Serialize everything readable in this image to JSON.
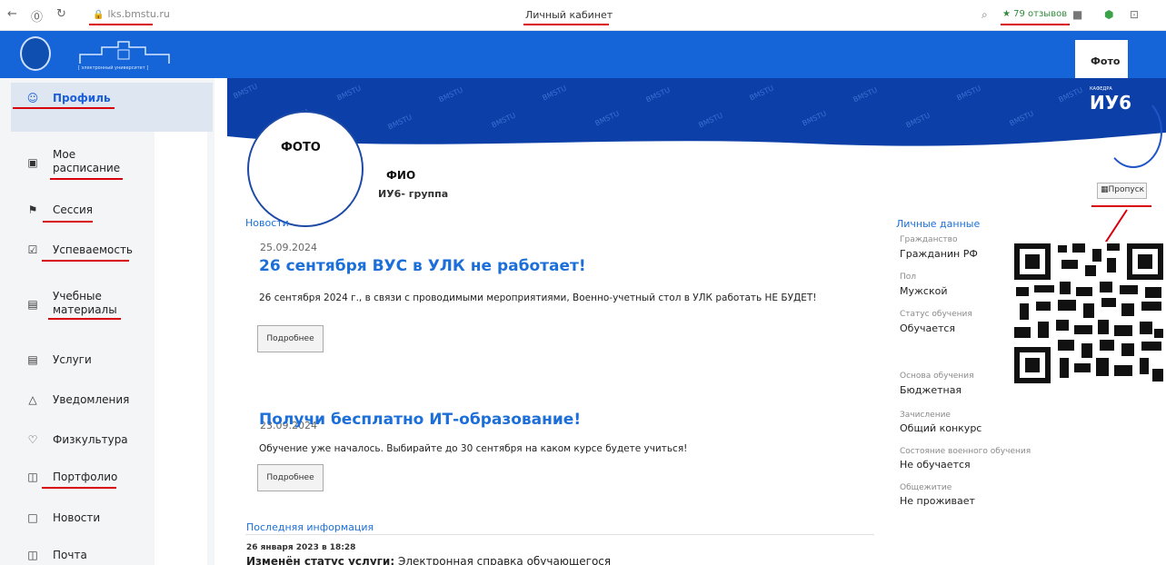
{
  "browser": {
    "url": "lks.bmstu.ru",
    "page_title": "Личный кабинет",
    "reviews": "★ 79 отзывов"
  },
  "header": {
    "logo_caption": "[ электронный университет ]",
    "photo_label": "Фото"
  },
  "sidebar": {
    "items": [
      {
        "label": "Профиль",
        "icon": "user-icon"
      },
      {
        "label": "Мое расписание",
        "icon": "calendar-icon"
      },
      {
        "label": "Сессия",
        "icon": "flag-icon"
      },
      {
        "label": "Успеваемость",
        "icon": "checkbox-icon"
      },
      {
        "label": "Учебные материалы",
        "icon": "document-icon"
      },
      {
        "label": "Услуги",
        "icon": "briefcase-icon"
      },
      {
        "label": "Уведомления",
        "icon": "bell-icon"
      },
      {
        "label": "Физкультура",
        "icon": "heart-icon"
      },
      {
        "label": "Портфолио",
        "icon": "folder-icon"
      },
      {
        "label": "Новости",
        "icon": "bookmark-icon"
      },
      {
        "label": "Почта",
        "icon": "mail-icon"
      }
    ]
  },
  "banner": {
    "watermark": "BMSTU",
    "kafedra_small": "КАФЕДРА",
    "kafedra_name": "ИУ6"
  },
  "profile": {
    "photo_label": "ФОТО",
    "fio": "ФИО",
    "group": "ИУ6- группа",
    "pass_button": "Пропуск"
  },
  "news": {
    "section_title": "Новости",
    "items": [
      {
        "date": "25.09.2024",
        "title": "26 сентября ВУС в УЛК не работает!",
        "text": "26 сентября 2024 г., в связи с проводимыми мероприятиями, Военно-учетный стол в УЛК работать НЕ БУДЕТ!",
        "button": "Подробнее"
      },
      {
        "date": "23.09.2024",
        "title": "Получи бесплатно ИТ-образование!",
        "text": "Обучение уже началось. Выбирайте до 30 сентября на каком курсе будете учиться!",
        "button": "Подробнее"
      }
    ]
  },
  "last_info": {
    "section_title": "Последняя информация",
    "date": "26 января 2023 в 18:28",
    "prefix": "Изменён статус услуги:",
    "text": "Электронная справка обучающегося"
  },
  "personal": {
    "section_title": "Личные данные",
    "fields": [
      {
        "label": "Гражданство",
        "value": "Гражданин РФ"
      },
      {
        "label": "Пол",
        "value": "Мужской"
      },
      {
        "label": "Статус обучения",
        "value": "Обучается"
      },
      {
        "label": "Основа обучения",
        "value": "Бюджетная"
      },
      {
        "label": "Зачисление",
        "value": "Общий конкурс"
      },
      {
        "label": "Состояние военного обучения",
        "value": "Не обучается"
      },
      {
        "label": "Общежитие",
        "value": "Не проживает"
      }
    ]
  },
  "colors": {
    "header_blue": "#1565d8",
    "banner_blue": "#0d3fa8",
    "link_blue": "#1c6fd8",
    "annotation_red": "#d8000c"
  }
}
